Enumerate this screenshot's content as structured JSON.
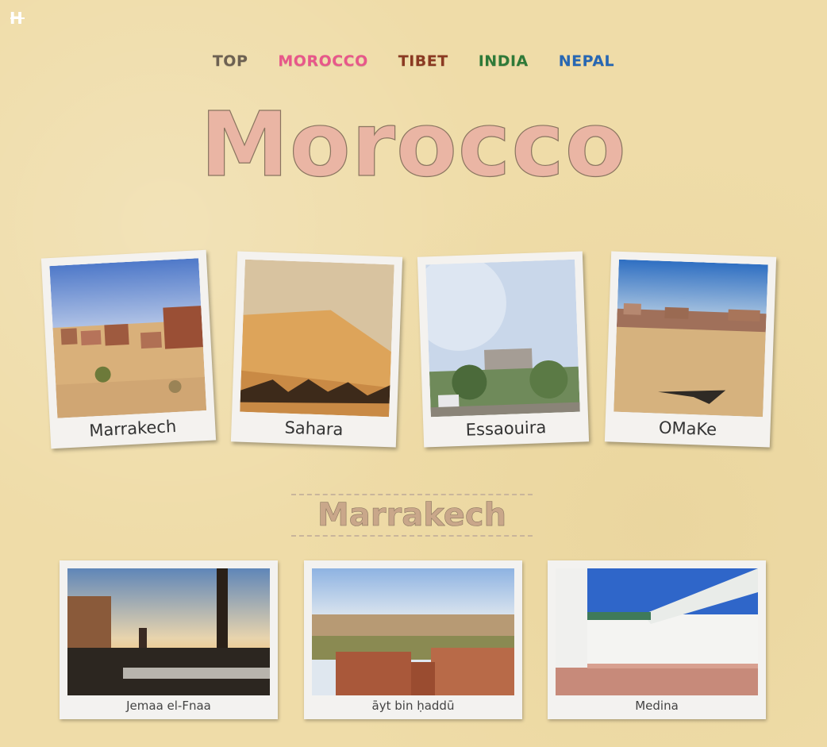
{
  "logo": "H",
  "nav": [
    {
      "label": "TOP",
      "color": "#6d6152"
    },
    {
      "label": "MOROCCO",
      "color": "#e8578a"
    },
    {
      "label": "TIBET",
      "color": "#8b3a22"
    },
    {
      "label": "INDIA",
      "color": "#2f7a38"
    },
    {
      "label": "NEPAL",
      "color": "#2767b3"
    }
  ],
  "title": "Morocco",
  "destinations": [
    {
      "label": "Marrakech"
    },
    {
      "label": "Sahara"
    },
    {
      "label": "Essaouira"
    },
    {
      "label": "OMaKe"
    }
  ],
  "section": {
    "title": "Marrakech"
  },
  "photos": [
    {
      "caption": "Jemaa el-Fnaa"
    },
    {
      "caption": "āyt bin ḥaddū"
    },
    {
      "caption": "Medina"
    }
  ]
}
